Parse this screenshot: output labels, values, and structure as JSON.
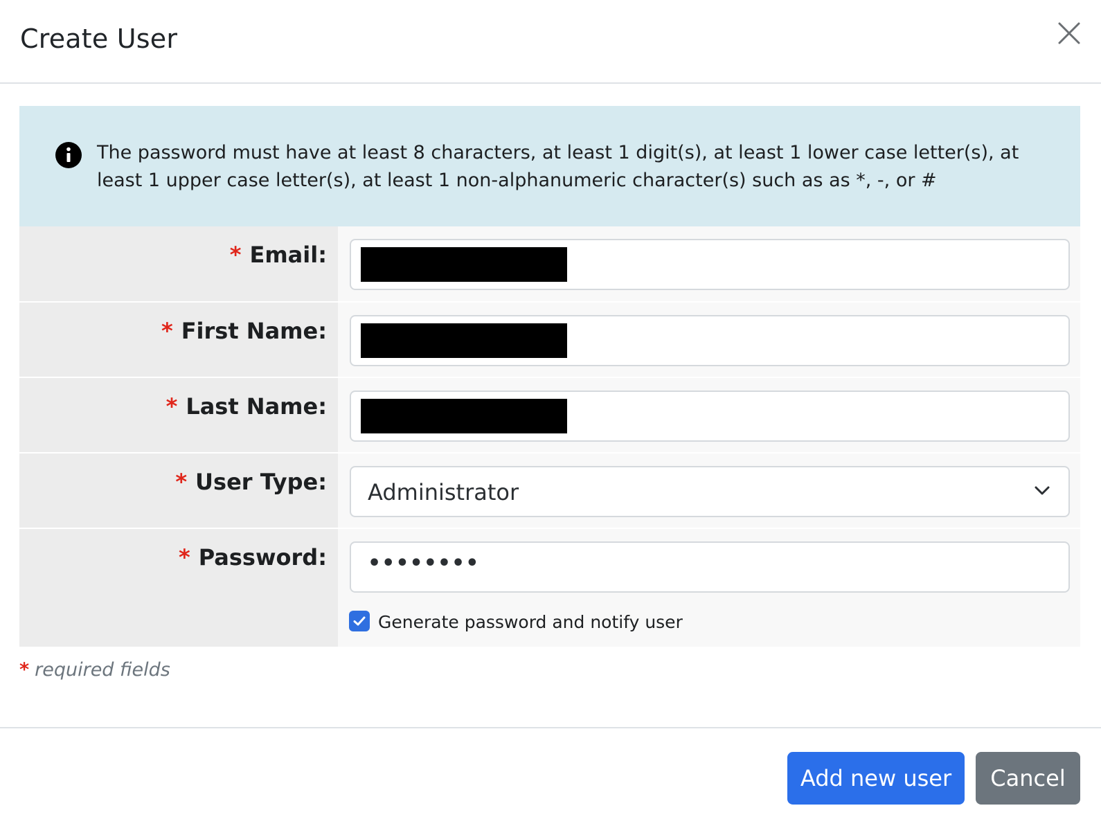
{
  "dialog": {
    "title": "Create User"
  },
  "alert": {
    "icon": "info-icon",
    "text": "The password must have at least 8 characters, at least 1 digit(s), at least 1 lower case letter(s), at least 1 upper case letter(s), at least 1 non-alphanumeric character(s) such as as *, -, or #"
  },
  "form": {
    "required_marker": "*",
    "fields": {
      "email": {
        "label": "Email:",
        "value": ""
      },
      "first_name": {
        "label": "First Name:",
        "value": ""
      },
      "last_name": {
        "label": "Last Name:",
        "value": ""
      },
      "user_type": {
        "label": "User Type:",
        "value": "Administrator"
      },
      "password": {
        "label": "Password:",
        "value": "••••••••"
      }
    },
    "generate_password": {
      "label": "Generate password and notify user",
      "checked": true
    }
  },
  "required_note": {
    "marker": "*",
    "text": "required fields"
  },
  "footer": {
    "primary_label": "Add new user",
    "cancel_label": "Cancel"
  },
  "colors": {
    "primary": "#2b6fea",
    "secondary": "#6c757d",
    "alert_bg": "#d6eaf0",
    "required": "#e0261b"
  }
}
